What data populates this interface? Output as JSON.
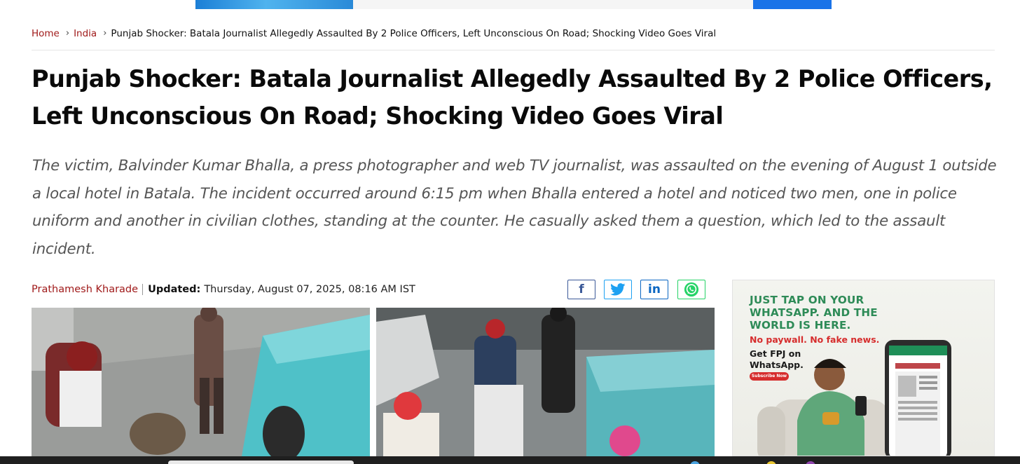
{
  "breadcrumb": {
    "home": "Home",
    "section": "India",
    "current": "Punjab Shocker: Batala Journalist Allegedly Assaulted By 2 Police Officers, Left Unconscious On Road; Shocking Video Goes Viral"
  },
  "article": {
    "headline": "Punjab Shocker: Batala Journalist Allegedly Assaulted By 2 Police Officers, Left Unconscious On Road; Shocking Video Goes Viral",
    "summary": "The victim, Balvinder Kumar Bhalla, a press photographer and web TV journalist, was assaulted on the evening of August 1 outside a local hotel in Batala. The incident occurred around 6:15 pm when Bhalla entered a hotel and noticed two men, one in police uniform and another in civilian clothes, standing at the counter. He casually asked them a question, which led to the assault incident.",
    "author": "Prathamesh Kharade",
    "updated_label": "Updated:",
    "updated_value": "Thursday, August 07, 2025, 08:16 AM IST"
  },
  "share": {
    "facebook_icon": "facebook-icon",
    "twitter_icon": "twitter-icon",
    "linkedin_icon": "linkedin-icon",
    "whatsapp_icon": "whatsapp-icon"
  },
  "side_ad": {
    "headline": "JUST TAP ON YOUR WHATSAPP. AND THE WORLD IS HERE.",
    "tagline": "No paywall. No fake news.",
    "cta_text": "Get FPJ on WhatsApp.",
    "button": "Subscribe Now",
    "accent": "#2e8b57",
    "red": "#d62d2d"
  },
  "colors": {
    "link": "#a01a1a",
    "headline": "#0a0a0a",
    "summary": "#555555"
  }
}
